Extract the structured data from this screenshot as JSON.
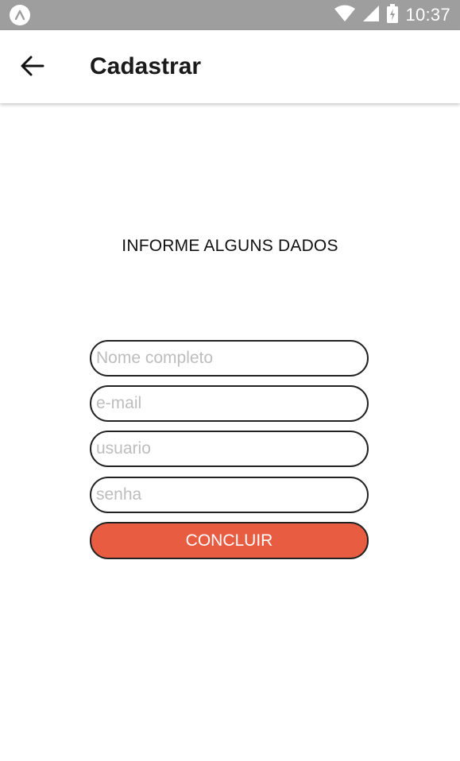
{
  "status_bar": {
    "time": "10:37",
    "icons": [
      "expo-app-icon",
      "wifi-icon",
      "signal-icon",
      "battery-icon"
    ]
  },
  "app_bar": {
    "title": "Cadastrar",
    "back_icon": "arrow-left-icon"
  },
  "form": {
    "heading": "INFORME ALGUNS DADOS",
    "fields": [
      {
        "placeholder": "Nome completo",
        "value": ""
      },
      {
        "placeholder": "e-mail",
        "value": ""
      },
      {
        "placeholder": "usuario",
        "value": ""
      },
      {
        "placeholder": "senha",
        "value": ""
      }
    ],
    "submit_label": "CONCLUIR"
  },
  "colors": {
    "status_bar": "#9e9e9e",
    "accent": "#e85c42",
    "border": "#222222",
    "placeholder": "#bdbdbd"
  }
}
